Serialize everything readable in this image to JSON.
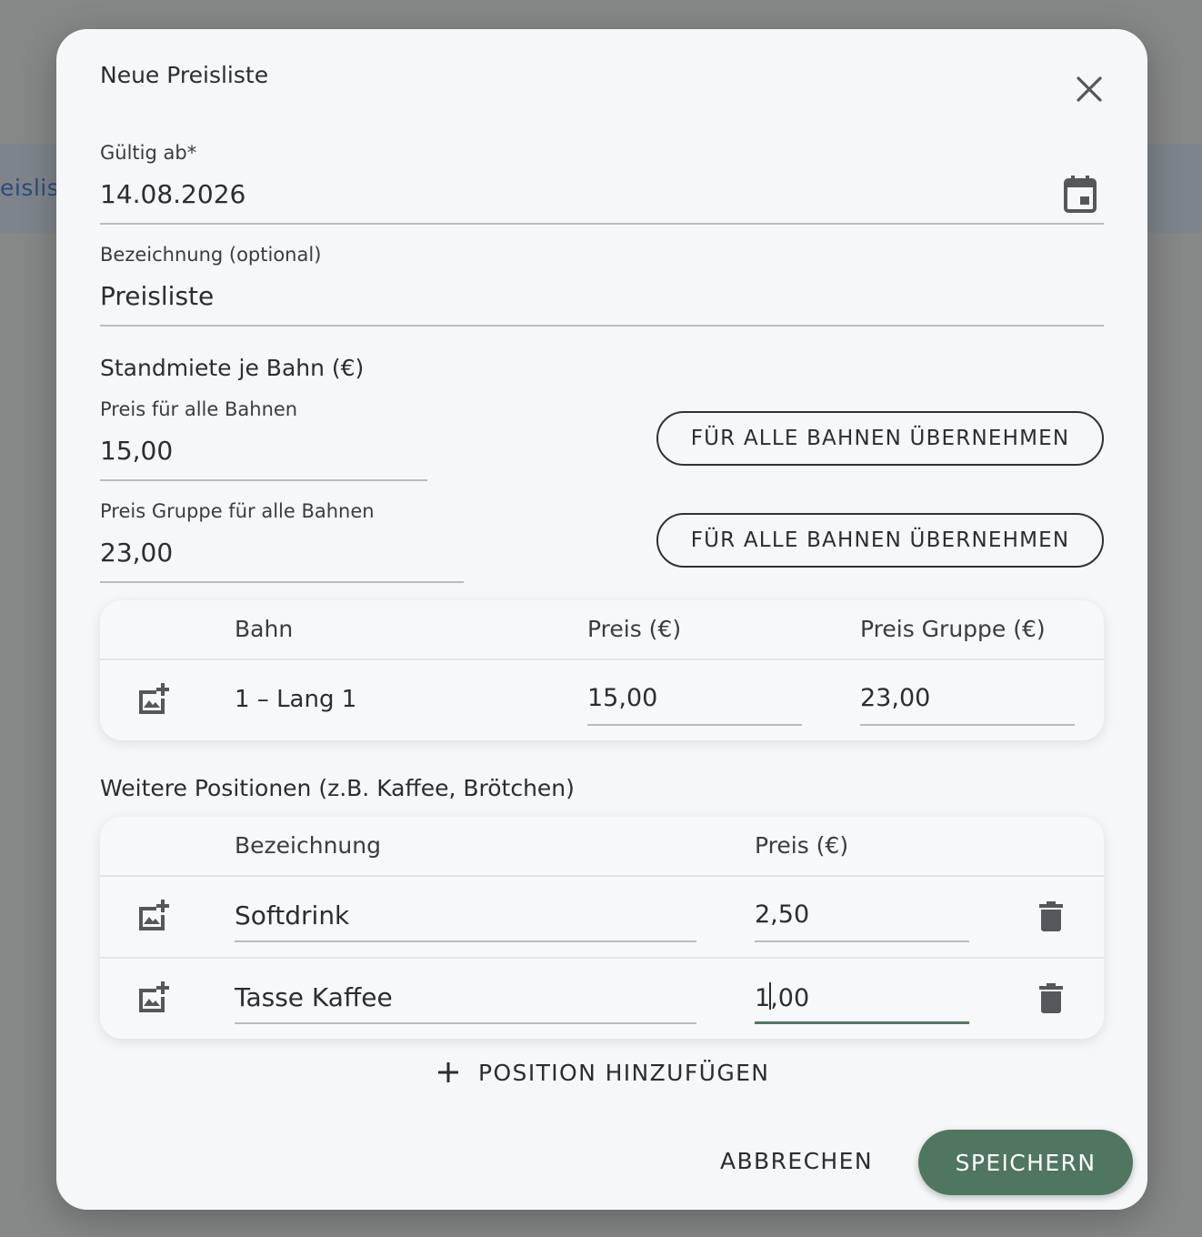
{
  "background": {
    "partial_text": "eislis"
  },
  "dialog": {
    "title": "Neue Preisliste",
    "close_icon": "close-icon"
  },
  "valid_from": {
    "label": "Gültig ab*",
    "value": "14.08.2026",
    "icon": "calendar-icon"
  },
  "designation": {
    "label": "Bezeichnung (optional)",
    "value": "Preisliste"
  },
  "stand_rent": {
    "section_title": "Standmiete je Bahn (€)",
    "price_all": {
      "label": "Preis für alle Bahnen",
      "value": "15,00",
      "apply_label": "FÜR ALLE BAHNEN ÜBERNEHMEN"
    },
    "group_price_all": {
      "label": "Preis Gruppe für alle Bahnen",
      "value": "23,00",
      "apply_label": "FÜR ALLE BAHNEN ÜBERNEHMEN"
    }
  },
  "lanes_table": {
    "headers": {
      "lane": "Bahn",
      "price": "Preis (€)",
      "group_price": "Preis Gruppe (€)"
    },
    "rows": [
      {
        "lane": "1 – Lang 1",
        "price": "15,00",
        "group_price": "23,00"
      }
    ]
  },
  "positions": {
    "section_title": "Weitere Positionen (z.B. Kaffee, Brötchen)",
    "headers": {
      "name": "Bezeichnung",
      "price": "Preis (€)"
    },
    "rows": [
      {
        "name": "Softdrink",
        "price": "2,50"
      },
      {
        "name": "Tasse Kaffee",
        "price_before_caret": "1",
        "price_after_caret": ",00"
      }
    ],
    "add_label": "POSITION HINZUFÜGEN"
  },
  "actions": {
    "cancel_label": "ABBRECHEN",
    "save_label": "SPEICHERN"
  },
  "colors": {
    "primary": "#4e7660",
    "dialog_bg": "#f6f7f9",
    "backdrop": "#868787"
  }
}
